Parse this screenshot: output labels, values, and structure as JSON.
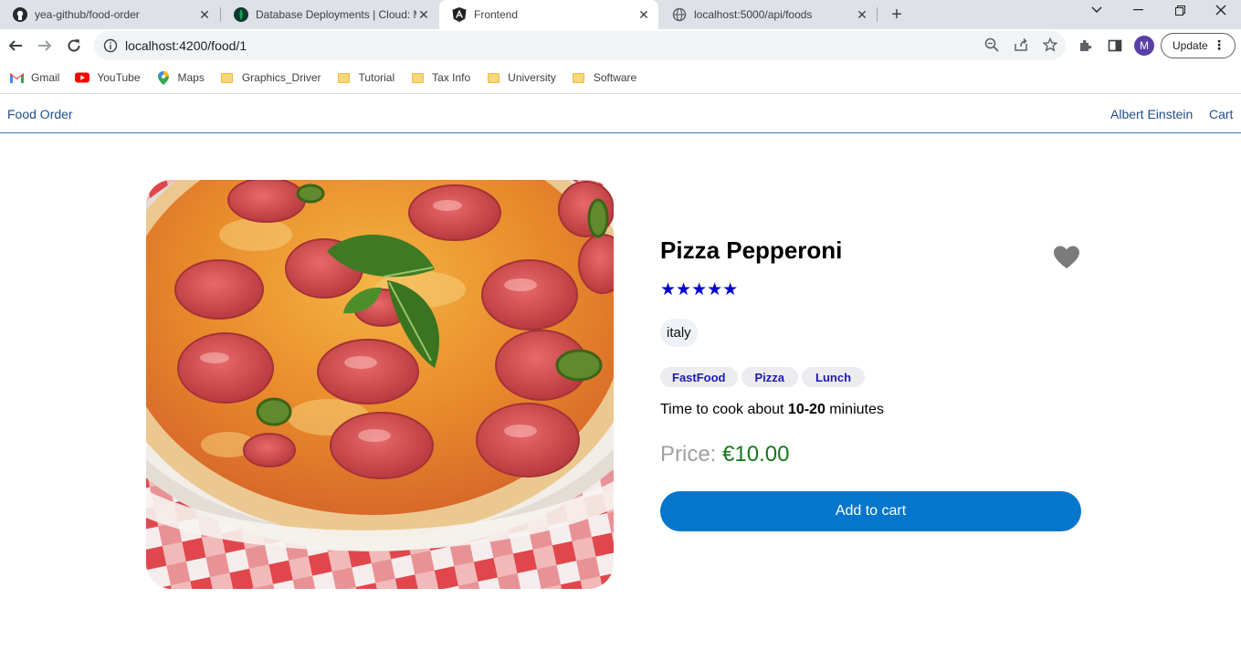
{
  "browser": {
    "tabs": [
      {
        "title": "yea-github/food-order",
        "icon": "github-icon"
      },
      {
        "title": "Database Deployments | Cloud: M",
        "icon": "mongodb-leaf-icon"
      },
      {
        "title": "Frontend",
        "icon": "angular-icon",
        "active": true
      },
      {
        "title": "localhost:5000/api/foods",
        "icon": "globe-icon"
      }
    ],
    "url": "localhost:4200/food/1",
    "update_label": "Update",
    "avatar_letter": "M",
    "bookmarks": [
      {
        "label": "Gmail",
        "icon": "gmail-icon"
      },
      {
        "label": "YouTube",
        "icon": "youtube-icon"
      },
      {
        "label": "Maps",
        "icon": "maps-pin-icon"
      },
      {
        "label": "Graphics_Driver",
        "icon": "folder-icon"
      },
      {
        "label": "Tutorial",
        "icon": "folder-icon"
      },
      {
        "label": "Tax Info",
        "icon": "folder-icon"
      },
      {
        "label": "University",
        "icon": "folder-icon"
      },
      {
        "label": "Software",
        "icon": "folder-icon"
      }
    ]
  },
  "header": {
    "brand": "Food Order",
    "user": "Albert Einstein",
    "cart": "Cart"
  },
  "food": {
    "name": "Pizza Pepperoni",
    "stars": "★★★★★",
    "rating": 5,
    "favorite": false,
    "origin": "italy",
    "tags": [
      "FastFood",
      "Pizza",
      "Lunch"
    ],
    "cook_prefix": "Time to cook about ",
    "cook_time": "10-20",
    "cook_suffix": " miniutes",
    "price_label": "Price: ",
    "price_value": "€10.00",
    "add_to_cart": "Add to cart"
  },
  "colors": {
    "accent": "#0676cc",
    "link": "#1e4f91",
    "price": "#16781a",
    "stars": "#0000cc"
  }
}
